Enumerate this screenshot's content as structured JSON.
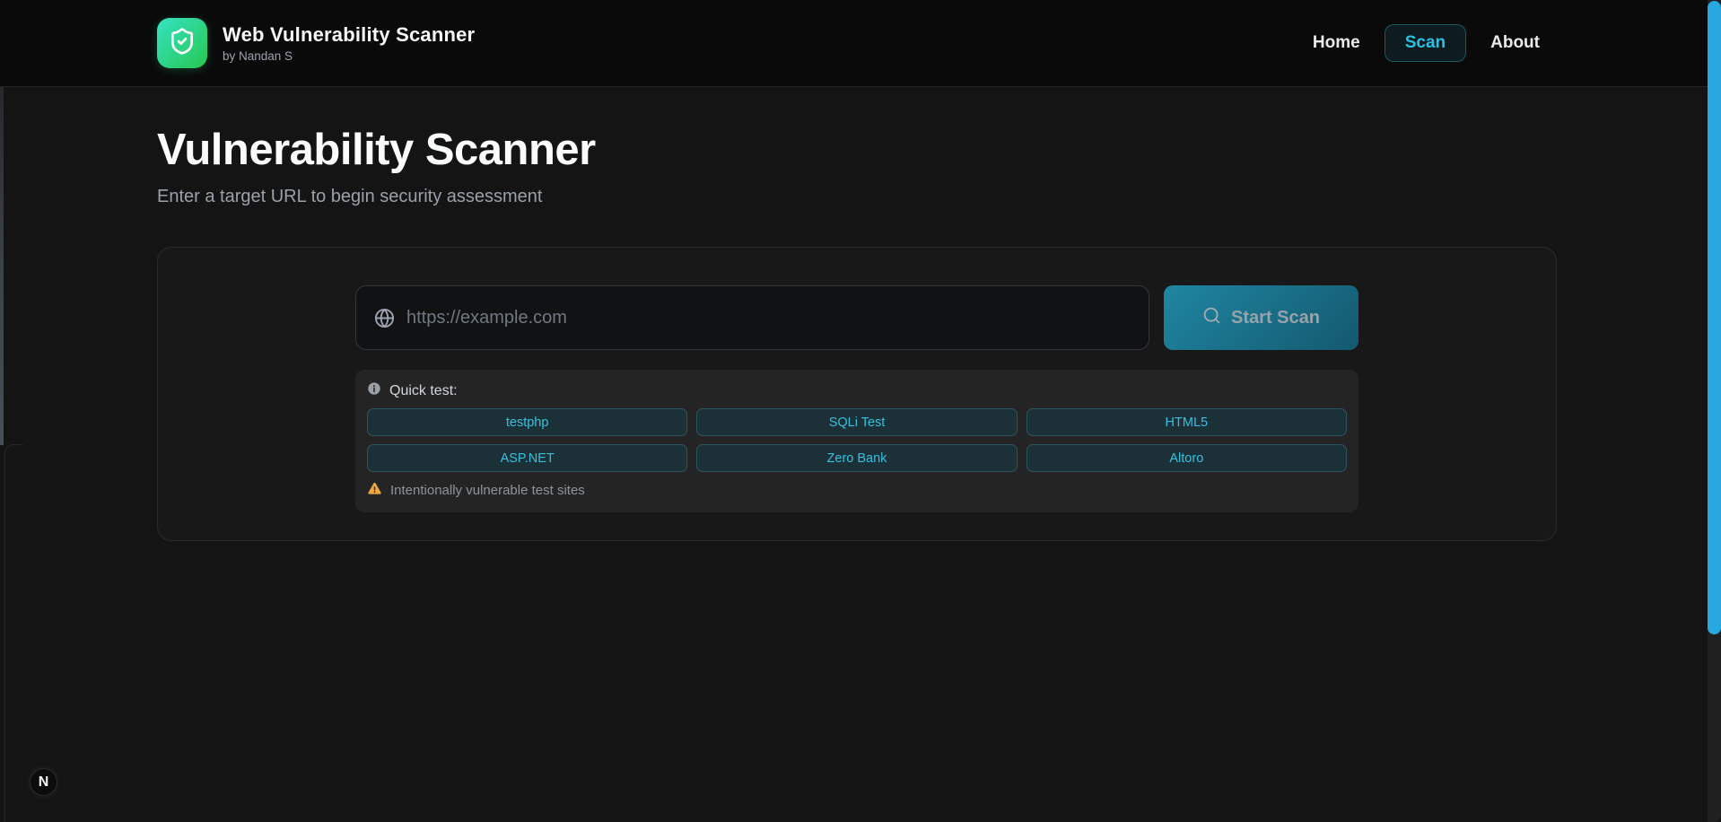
{
  "navbar": {
    "brand": {
      "title": "Web Vulnerability Scanner",
      "subtitle": "by Nandan S",
      "logo_icon": "shield-check-icon"
    },
    "links": [
      {
        "label": "Home",
        "active": false
      },
      {
        "label": "Scan",
        "active": true
      },
      {
        "label": "About",
        "active": false
      }
    ]
  },
  "hero": {
    "title": "Vulnerability Scanner",
    "subtitle": "Enter a target URL to begin security assessment"
  },
  "scan_card": {
    "url_input": {
      "value": "",
      "placeholder": "https://example.com",
      "icon": "globe-icon"
    },
    "start_button": {
      "label": "Start Scan",
      "icon": "search-icon"
    },
    "quick_test": {
      "icon": "info-icon",
      "label": "Quick test:",
      "sites": [
        "testphp",
        "SQLi Test",
        "HTML5",
        "ASP.NET",
        "Zero Bank",
        "Altoro"
      ],
      "warning": {
        "icon": "warning-triangle-icon",
        "text": "Intentionally vulnerable test sites"
      }
    }
  },
  "dev_badge": {
    "label": "N"
  },
  "colors": {
    "page_background": "#141414",
    "navbar_background": "#0a0a0a",
    "accent_cyan": "#29c0e8",
    "quick_button_text": "#38c0e0",
    "logo_gradient_start": "#35e2c3",
    "logo_gradient_end": "#28c750",
    "start_button_gradient_start": "#1f86a2",
    "start_button_gradient_end": "#14596f",
    "warning_amber": "#eca840",
    "scrollbar_thumb_blue": "#28a7e0"
  }
}
